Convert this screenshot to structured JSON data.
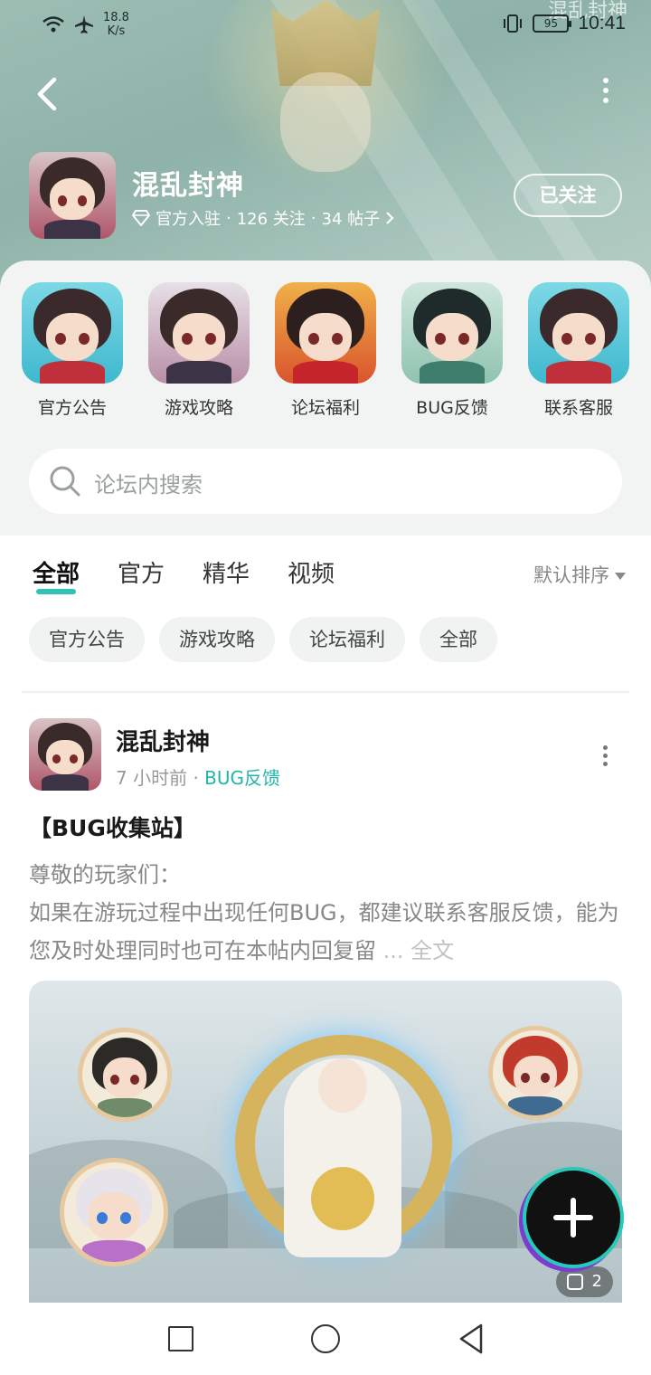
{
  "status_bar": {
    "net_speed": "18.8",
    "net_unit": "K/s",
    "battery": "95",
    "time": "10:41"
  },
  "forum": {
    "name": "混乱封神",
    "verified_label": "官方入驻",
    "follow_count": "126 关注",
    "post_count": "34 帖子",
    "follow_button": "已关注",
    "header_logo_text": "混乱封神"
  },
  "categories": [
    {
      "label": "官方公告"
    },
    {
      "label": "游戏攻略"
    },
    {
      "label": "论坛福利"
    },
    {
      "label": "BUG反馈"
    },
    {
      "label": "联系客服"
    }
  ],
  "search": {
    "placeholder": "论坛内搜索"
  },
  "tabs": [
    {
      "label": "全部"
    },
    {
      "label": "官方"
    },
    {
      "label": "精华"
    },
    {
      "label": "视频"
    }
  ],
  "sort_label": "默认排序",
  "chips": [
    {
      "label": "官方公告"
    },
    {
      "label": "游戏攻略"
    },
    {
      "label": "论坛福利"
    },
    {
      "label": "全部"
    }
  ],
  "post": {
    "author": "混乱封神",
    "time": "7 小时前",
    "separator": "·",
    "forum_tag": "BUG反馈",
    "title": "【BUG收集站】",
    "body_line1": "尊敬的玩家们：",
    "body_line2": " 如果在游玩过程中出现任何BUG，都建议联系客服反馈，能为您及时处理同时也可在本帖内回复留",
    "ellipsis": " ...",
    "full_text_link": " 全文",
    "image_count": "2"
  },
  "colors": {
    "accent": "#2ec3b3",
    "tag_color": "#20b6a8"
  }
}
